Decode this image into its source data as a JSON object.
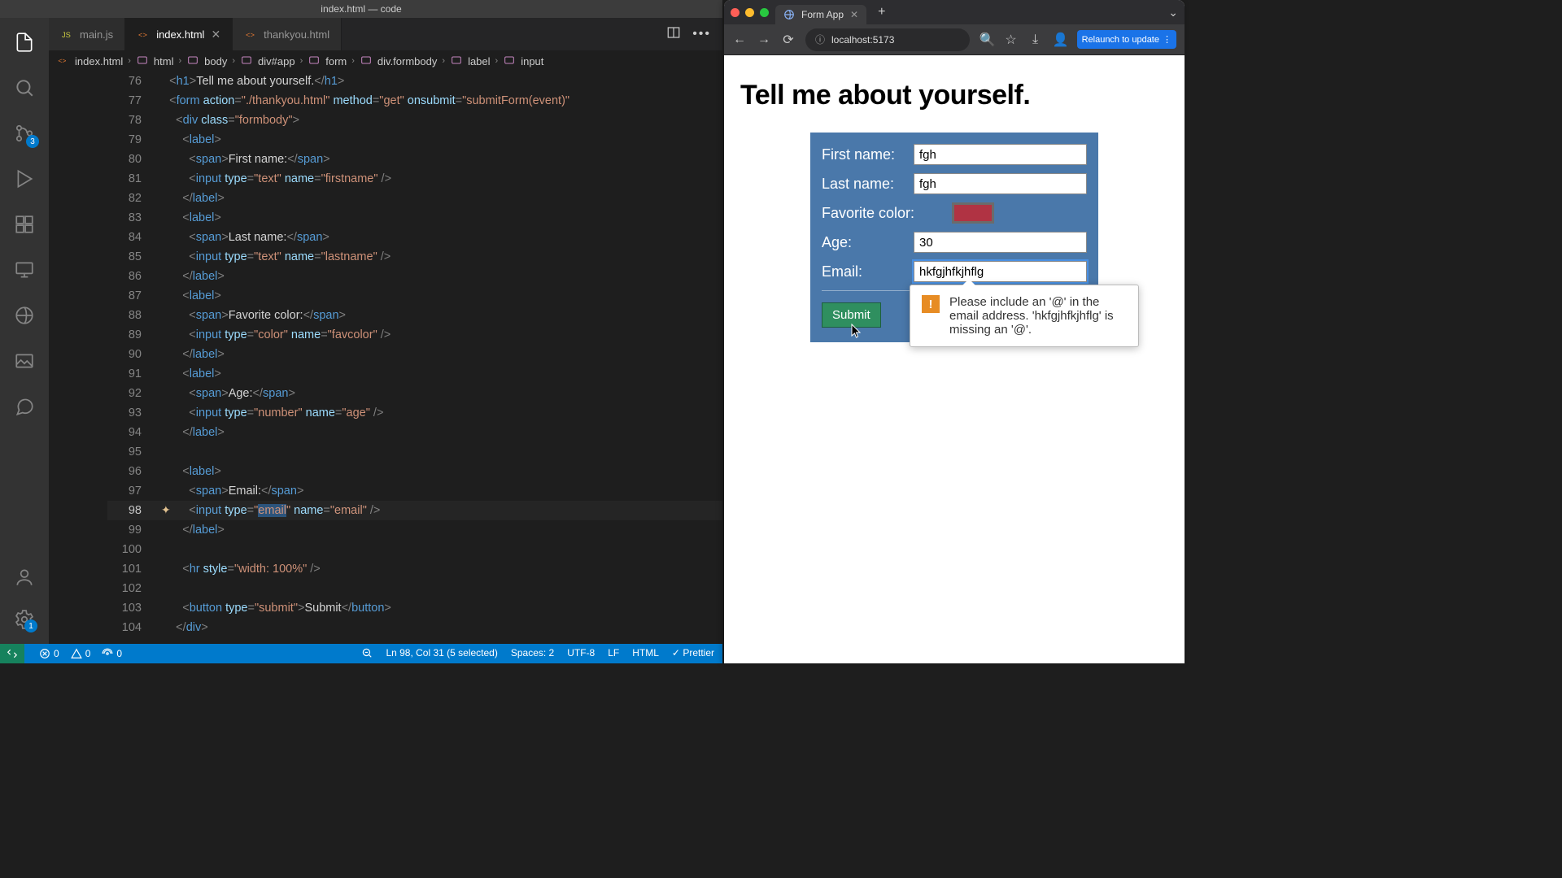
{
  "vscode": {
    "windowTitle": "index.html — code",
    "tabs": [
      {
        "label": "main.js",
        "type": "js",
        "active": false,
        "close": false
      },
      {
        "label": "index.html",
        "type": "html",
        "active": true,
        "close": true
      },
      {
        "label": "thankyou.html",
        "type": "html",
        "active": false,
        "close": false
      }
    ],
    "breadcrumbs": [
      "index.html",
      "html",
      "body",
      "div#app",
      "form",
      "div.formbody",
      "label",
      "input"
    ],
    "activity": {
      "scmBadge": "3",
      "settingsBadge": "1"
    },
    "code": {
      "startLine": 76,
      "currentLine": 98,
      "lines": [
        [
          [
            "pun",
            "<"
          ],
          [
            "tagn",
            "h1"
          ],
          [
            "pun",
            ">"
          ],
          [
            "txt",
            "Tell me about yourself."
          ],
          [
            "pun",
            "</"
          ],
          [
            "tagn",
            "h1"
          ],
          [
            "pun",
            ">"
          ]
        ],
        [
          [
            "pun",
            "<"
          ],
          [
            "tagn",
            "form"
          ],
          [
            "txt",
            " "
          ],
          [
            "attr",
            "action"
          ],
          [
            "pun",
            "="
          ],
          [
            "str",
            "\"./thankyou.html\""
          ],
          [
            "txt",
            " "
          ],
          [
            "attr",
            "method"
          ],
          [
            "pun",
            "="
          ],
          [
            "str",
            "\"get\""
          ],
          [
            "txt",
            " "
          ],
          [
            "attr",
            "onsubmit"
          ],
          [
            "pun",
            "="
          ],
          [
            "str",
            "\"submitForm(event)\""
          ]
        ],
        [
          [
            "pun",
            "  <"
          ],
          [
            "tagn",
            "div"
          ],
          [
            "txt",
            " "
          ],
          [
            "attr",
            "class"
          ],
          [
            "pun",
            "="
          ],
          [
            "str",
            "\"formbody\""
          ],
          [
            "pun",
            ">"
          ]
        ],
        [
          [
            "pun",
            "    <"
          ],
          [
            "tagn",
            "label"
          ],
          [
            "pun",
            ">"
          ]
        ],
        [
          [
            "pun",
            "      <"
          ],
          [
            "tagn",
            "span"
          ],
          [
            "pun",
            ">"
          ],
          [
            "txt",
            "First name:"
          ],
          [
            "pun",
            "</"
          ],
          [
            "tagn",
            "span"
          ],
          [
            "pun",
            ">"
          ]
        ],
        [
          [
            "pun",
            "      <"
          ],
          [
            "tagn",
            "input"
          ],
          [
            "txt",
            " "
          ],
          [
            "attr",
            "type"
          ],
          [
            "pun",
            "="
          ],
          [
            "str",
            "\"text\""
          ],
          [
            "txt",
            " "
          ],
          [
            "attr",
            "name"
          ],
          [
            "pun",
            "="
          ],
          [
            "str",
            "\"firstname\""
          ],
          [
            "pun",
            " />"
          ]
        ],
        [
          [
            "pun",
            "    </"
          ],
          [
            "tagn",
            "label"
          ],
          [
            "pun",
            ">"
          ]
        ],
        [
          [
            "pun",
            "    <"
          ],
          [
            "tagn",
            "label"
          ],
          [
            "pun",
            ">"
          ]
        ],
        [
          [
            "pun",
            "      <"
          ],
          [
            "tagn",
            "span"
          ],
          [
            "pun",
            ">"
          ],
          [
            "txt",
            "Last name:"
          ],
          [
            "pun",
            "</"
          ],
          [
            "tagn",
            "span"
          ],
          [
            "pun",
            ">"
          ]
        ],
        [
          [
            "pun",
            "      <"
          ],
          [
            "tagn",
            "input"
          ],
          [
            "txt",
            " "
          ],
          [
            "attr",
            "type"
          ],
          [
            "pun",
            "="
          ],
          [
            "str",
            "\"text\""
          ],
          [
            "txt",
            " "
          ],
          [
            "attr",
            "name"
          ],
          [
            "pun",
            "="
          ],
          [
            "str",
            "\"lastname\""
          ],
          [
            "pun",
            " />"
          ]
        ],
        [
          [
            "pun",
            "    </"
          ],
          [
            "tagn",
            "label"
          ],
          [
            "pun",
            ">"
          ]
        ],
        [
          [
            "pun",
            "    <"
          ],
          [
            "tagn",
            "label"
          ],
          [
            "pun",
            ">"
          ]
        ],
        [
          [
            "pun",
            "      <"
          ],
          [
            "tagn",
            "span"
          ],
          [
            "pun",
            ">"
          ],
          [
            "txt",
            "Favorite color:"
          ],
          [
            "pun",
            "</"
          ],
          [
            "tagn",
            "span"
          ],
          [
            "pun",
            ">"
          ]
        ],
        [
          [
            "pun",
            "      <"
          ],
          [
            "tagn",
            "input"
          ],
          [
            "txt",
            " "
          ],
          [
            "attr",
            "type"
          ],
          [
            "pun",
            "="
          ],
          [
            "str",
            "\"color\""
          ],
          [
            "txt",
            " "
          ],
          [
            "attr",
            "name"
          ],
          [
            "pun",
            "="
          ],
          [
            "str",
            "\"favcolor\""
          ],
          [
            "pun",
            " />"
          ]
        ],
        [
          [
            "pun",
            "    </"
          ],
          [
            "tagn",
            "label"
          ],
          [
            "pun",
            ">"
          ]
        ],
        [
          [
            "pun",
            "    <"
          ],
          [
            "tagn",
            "label"
          ],
          [
            "pun",
            ">"
          ]
        ],
        [
          [
            "pun",
            "      <"
          ],
          [
            "tagn",
            "span"
          ],
          [
            "pun",
            ">"
          ],
          [
            "txt",
            "Age:"
          ],
          [
            "pun",
            "</"
          ],
          [
            "tagn",
            "span"
          ],
          [
            "pun",
            ">"
          ]
        ],
        [
          [
            "pun",
            "      <"
          ],
          [
            "tagn",
            "input"
          ],
          [
            "txt",
            " "
          ],
          [
            "attr",
            "type"
          ],
          [
            "pun",
            "="
          ],
          [
            "str",
            "\"number\""
          ],
          [
            "txt",
            " "
          ],
          [
            "attr",
            "name"
          ],
          [
            "pun",
            "="
          ],
          [
            "str",
            "\"age\""
          ],
          [
            "pun",
            " />"
          ]
        ],
        [
          [
            "pun",
            "    </"
          ],
          [
            "tagn",
            "label"
          ],
          [
            "pun",
            ">"
          ]
        ],
        [],
        [
          [
            "pun",
            "    <"
          ],
          [
            "tagn",
            "label"
          ],
          [
            "pun",
            ">"
          ]
        ],
        [
          [
            "pun",
            "      <"
          ],
          [
            "tagn",
            "span"
          ],
          [
            "pun",
            ">"
          ],
          [
            "txt",
            "Email:"
          ],
          [
            "pun",
            "</"
          ],
          [
            "tagn",
            "span"
          ],
          [
            "pun",
            ">"
          ]
        ],
        [
          [
            "pun",
            "      <"
          ],
          [
            "tagn",
            "input"
          ],
          [
            "txt",
            " "
          ],
          [
            "attr",
            "type"
          ],
          [
            "pun",
            "="
          ],
          [
            "str",
            "\""
          ],
          [
            "strsel",
            "email"
          ],
          [
            "str",
            "\""
          ],
          [
            "txt",
            " "
          ],
          [
            "attr",
            "name"
          ],
          [
            "pun",
            "="
          ],
          [
            "str",
            "\"email\""
          ],
          [
            "pun",
            " />"
          ]
        ],
        [
          [
            "pun",
            "    </"
          ],
          [
            "tagn",
            "label"
          ],
          [
            "pun",
            ">"
          ]
        ],
        [],
        [
          [
            "pun",
            "    <"
          ],
          [
            "tagn",
            "hr"
          ],
          [
            "txt",
            " "
          ],
          [
            "attr",
            "style"
          ],
          [
            "pun",
            "="
          ],
          [
            "str",
            "\"width: 100%\""
          ],
          [
            "pun",
            " />"
          ]
        ],
        [],
        [
          [
            "pun",
            "    <"
          ],
          [
            "tagn",
            "button"
          ],
          [
            "txt",
            " "
          ],
          [
            "attr",
            "type"
          ],
          [
            "pun",
            "="
          ],
          [
            "str",
            "\"submit\""
          ],
          [
            "pun",
            ">"
          ],
          [
            "txt",
            "Submit"
          ],
          [
            "pun",
            "</"
          ],
          [
            "tagn",
            "button"
          ],
          [
            "pun",
            ">"
          ]
        ],
        [
          [
            "pun",
            "  </"
          ],
          [
            "tagn",
            "div"
          ],
          [
            "pun",
            ">"
          ]
        ]
      ]
    },
    "status": {
      "errors": "0",
      "warnings": "0",
      "ports": "0",
      "cursor": "Ln 98, Col 31 (5 selected)",
      "spaces": "Spaces: 2",
      "encoding": "UTF-8",
      "eol": "LF",
      "lang": "HTML",
      "formatter": "Prettier"
    }
  },
  "browser": {
    "tabTitle": "Form App",
    "url": "localhost:5173",
    "relaunch": "Relaunch to update",
    "page": {
      "heading": "Tell me about yourself.",
      "labels": {
        "first": "First name:",
        "last": "Last name:",
        "color": "Favorite color:",
        "age": "Age:",
        "email": "Email:"
      },
      "values": {
        "first": "fgh",
        "last": "fgh",
        "age": "30",
        "email": "hkfgjhfkjhflg",
        "color": "#b03343"
      },
      "submit": "Submit",
      "tooltip": "Please include an '@' in the email address. 'hkfgjhfkjhflg' is missing an '@'."
    }
  }
}
